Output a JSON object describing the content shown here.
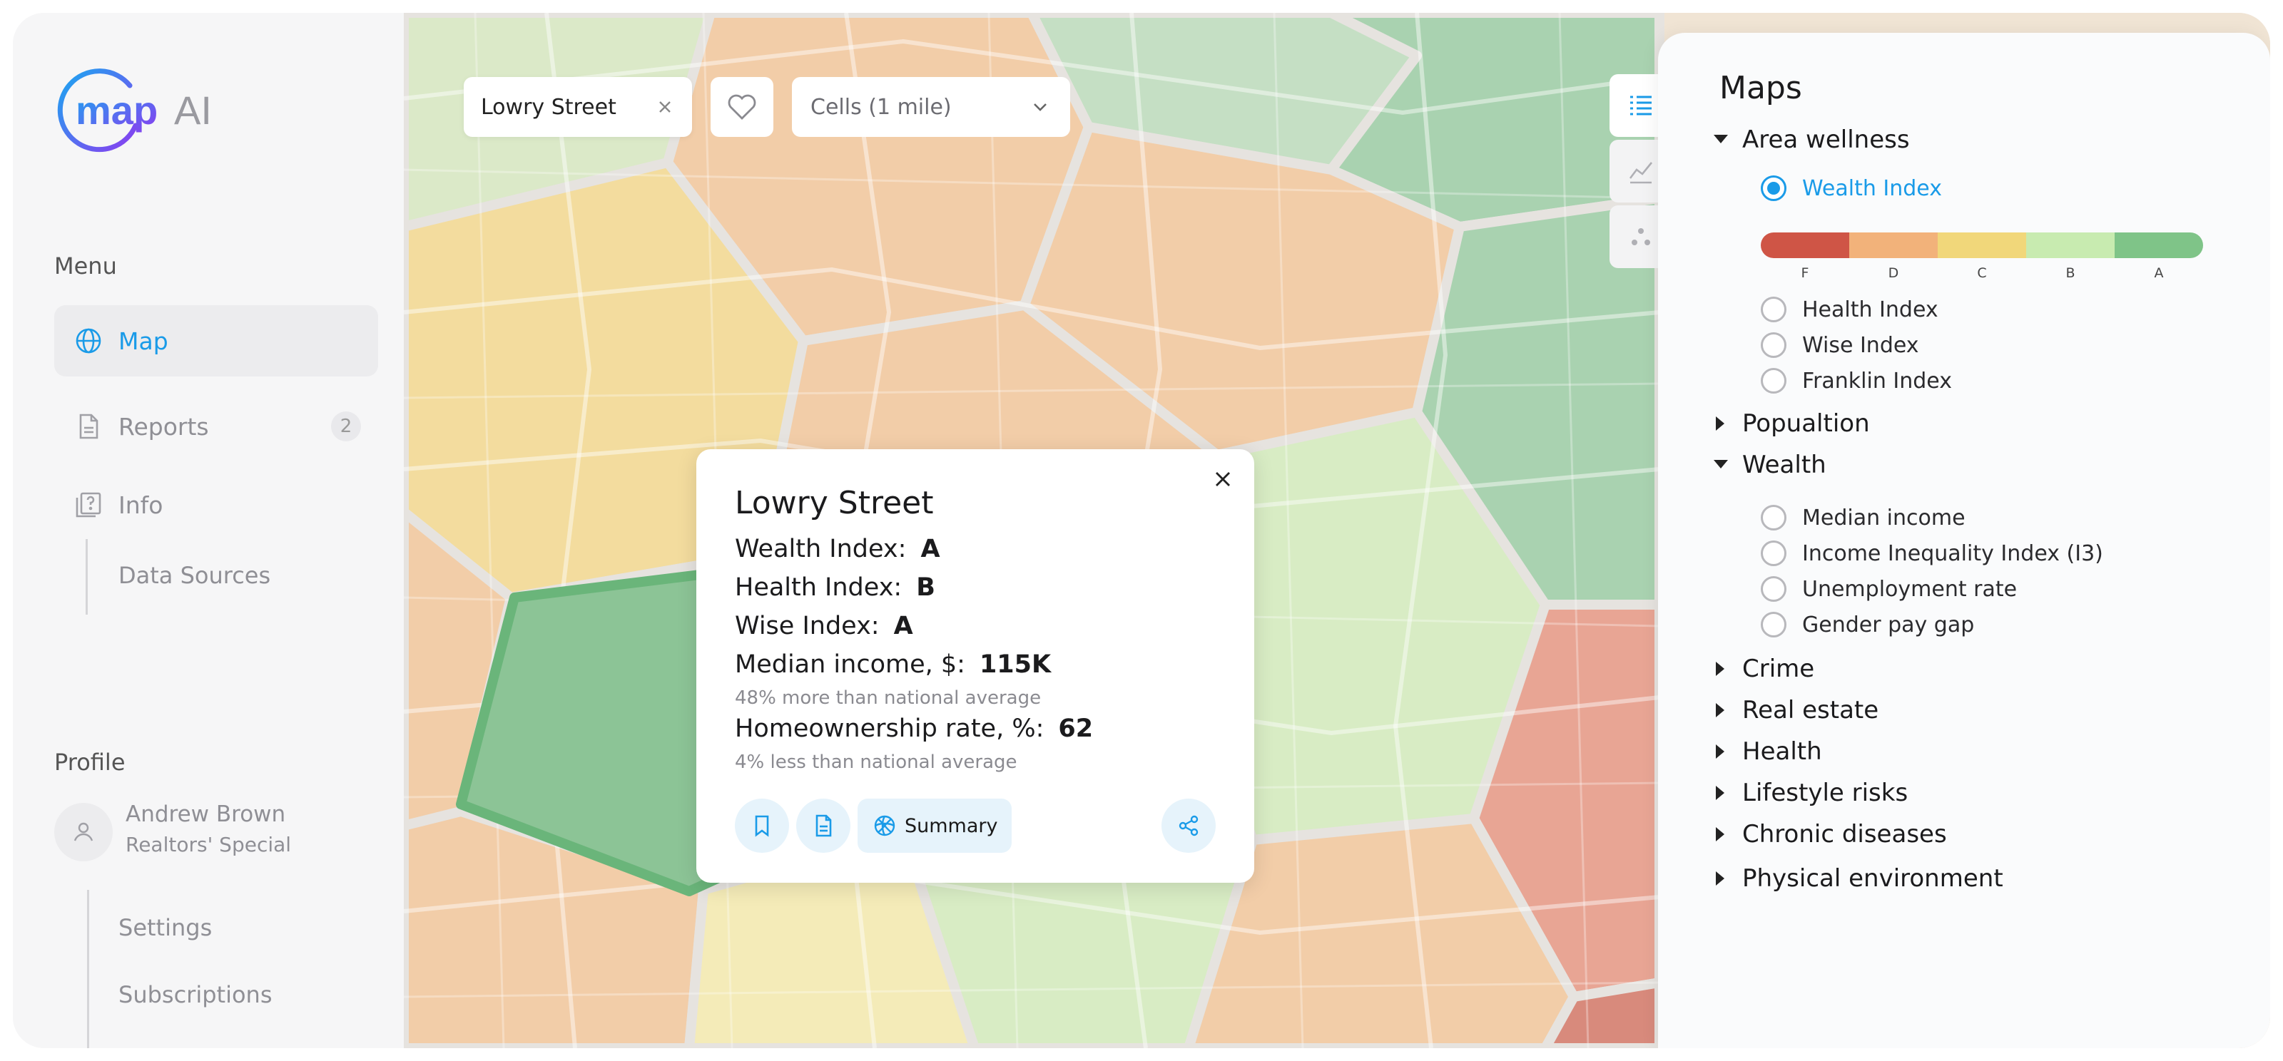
{
  "app": {
    "logo_main": "map",
    "logo_suffix": "AI"
  },
  "sidebar": {
    "menu_title": "Menu",
    "items": [
      {
        "label": "Map",
        "icon": "globe-icon",
        "active": true
      },
      {
        "label": "Reports",
        "icon": "document-icon",
        "badge": "2"
      },
      {
        "label": "Info",
        "icon": "info-book-icon"
      }
    ],
    "info_sub": "Data Sources",
    "profile_title": "Profile",
    "profile": {
      "name": "Andrew Brown",
      "role": "Realtors' Special"
    },
    "profile_sub": [
      "Settings",
      "Subscriptions"
    ]
  },
  "toolbar": {
    "search_value": "Lowry Street",
    "cells_select": "Cells (1 mile)"
  },
  "card": {
    "title": "Lowry Street",
    "rows": [
      {
        "label": "Wealth Index:",
        "value": "A"
      },
      {
        "label": "Health Index:",
        "value": "B"
      },
      {
        "label": "Wise Index:",
        "value": "A"
      },
      {
        "label": "Median income, $:",
        "value": "115K",
        "note": "48% more than national average"
      },
      {
        "label": "Homeownership rate, %:",
        "value": "62",
        "note": "4% less than national average"
      }
    ],
    "summary_label": "Summary"
  },
  "panel": {
    "title": "Maps",
    "area_wellness": "Area wellness",
    "wellness_options": [
      "Wealth Index",
      "Health Index",
      "Wise Index",
      "Franklin Index"
    ],
    "grades": [
      "F",
      "D",
      "C",
      "B",
      "A"
    ],
    "grade_colors": [
      "#cf5546",
      "#f2b27a",
      "#f1d77a",
      "#c8ebb0",
      "#7fc488"
    ],
    "population": "Popualtion",
    "wealth": "Wealth",
    "wealth_options": [
      "Median income",
      "Income Inequality Index (I3)",
      "Unemployment rate",
      "Gender pay gap"
    ],
    "collapsed": [
      "Crime",
      "Real estate",
      "Health",
      "Lifestyle risks",
      "Chronic diseases",
      "Physical environment"
    ]
  },
  "colors": {
    "accent": "#1a9be8",
    "logo_purple": "#8b3cf0"
  }
}
